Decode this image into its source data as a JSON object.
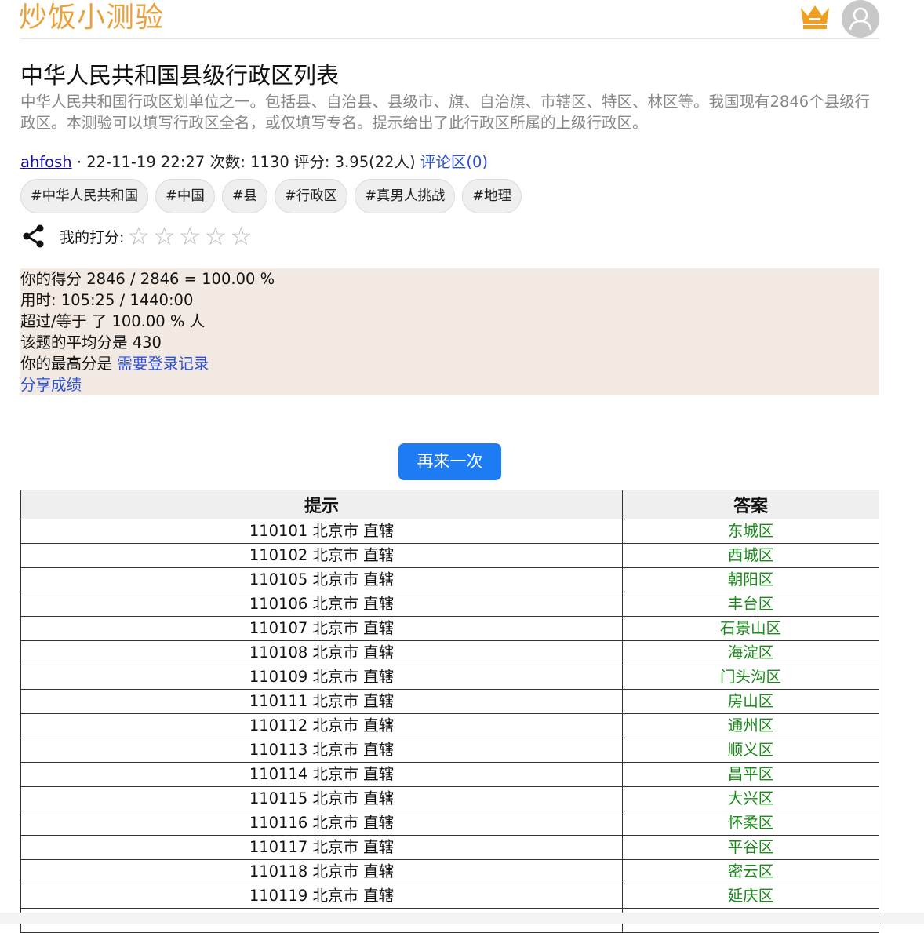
{
  "header": {
    "brand": "炒饭小测验",
    "crown_icon": "crown-icon",
    "avatar_icon": "user-avatar-icon",
    "brand_color": "#e9a23b"
  },
  "quiz": {
    "title": "中华人民共和国县级行政区列表",
    "description": "中华人民共和国行政区划单位之一。包括县、自治县、县级市、旗、自治旗、市辖区、特区、林区等。我国现有2846个县级行政区。本测验可以填写行政区全名，或仅填写专名。提示给出了此行政区所属的上级行政区。",
    "author": "ahfosh",
    "meta_text": " · 22-11-19 22:27 次数: 1130 评分: 3.95(22人) ",
    "comments_link": "评论区(0)",
    "tags": [
      "#中华人民共和国",
      "#中国",
      "#县",
      "#行政区",
      "#真男人挑战",
      "#地理"
    ]
  },
  "rating": {
    "label": "我的打分:",
    "star_glyph": "☆",
    "stars": 5,
    "score": 0,
    "share_icon": "share-icon"
  },
  "result": {
    "score_line": "你的得分 2846 / 2846 = 100.00 %",
    "time_line": "用时: 105:25 / 1440:00",
    "percentile_line": "超过/等于 了 100.00 % 人",
    "average_line": "该题的平均分是 430",
    "best_prefix": "你的最高分是 ",
    "best_link": "需要登录记录",
    "share_link": "分享成绩"
  },
  "again_button": "再来一次",
  "table": {
    "headers": [
      "提示",
      "答案"
    ],
    "rows": [
      {
        "hint": "110101 北京市 直辖",
        "answer": "东城区"
      },
      {
        "hint": "110102 北京市 直辖",
        "answer": "西城区"
      },
      {
        "hint": "110105 北京市 直辖",
        "answer": "朝阳区"
      },
      {
        "hint": "110106 北京市 直辖",
        "answer": "丰台区"
      },
      {
        "hint": "110107 北京市 直辖",
        "answer": "石景山区"
      },
      {
        "hint": "110108 北京市 直辖",
        "answer": "海淀区"
      },
      {
        "hint": "110109 北京市 直辖",
        "answer": "门头沟区"
      },
      {
        "hint": "110111 北京市 直辖",
        "answer": "房山区"
      },
      {
        "hint": "110112 北京市 直辖",
        "answer": "通州区"
      },
      {
        "hint": "110113 北京市 直辖",
        "answer": "顺义区"
      },
      {
        "hint": "110114 北京市 直辖",
        "answer": "昌平区"
      },
      {
        "hint": "110115 北京市 直辖",
        "answer": "大兴区"
      },
      {
        "hint": "110116 北京市 直辖",
        "answer": "怀柔区"
      },
      {
        "hint": "110117 北京市 直辖",
        "answer": "平谷区"
      },
      {
        "hint": "110118 北京市 直辖",
        "answer": "密云区"
      },
      {
        "hint": "110119 北京市 直辖",
        "answer": "延庆区"
      }
    ]
  }
}
